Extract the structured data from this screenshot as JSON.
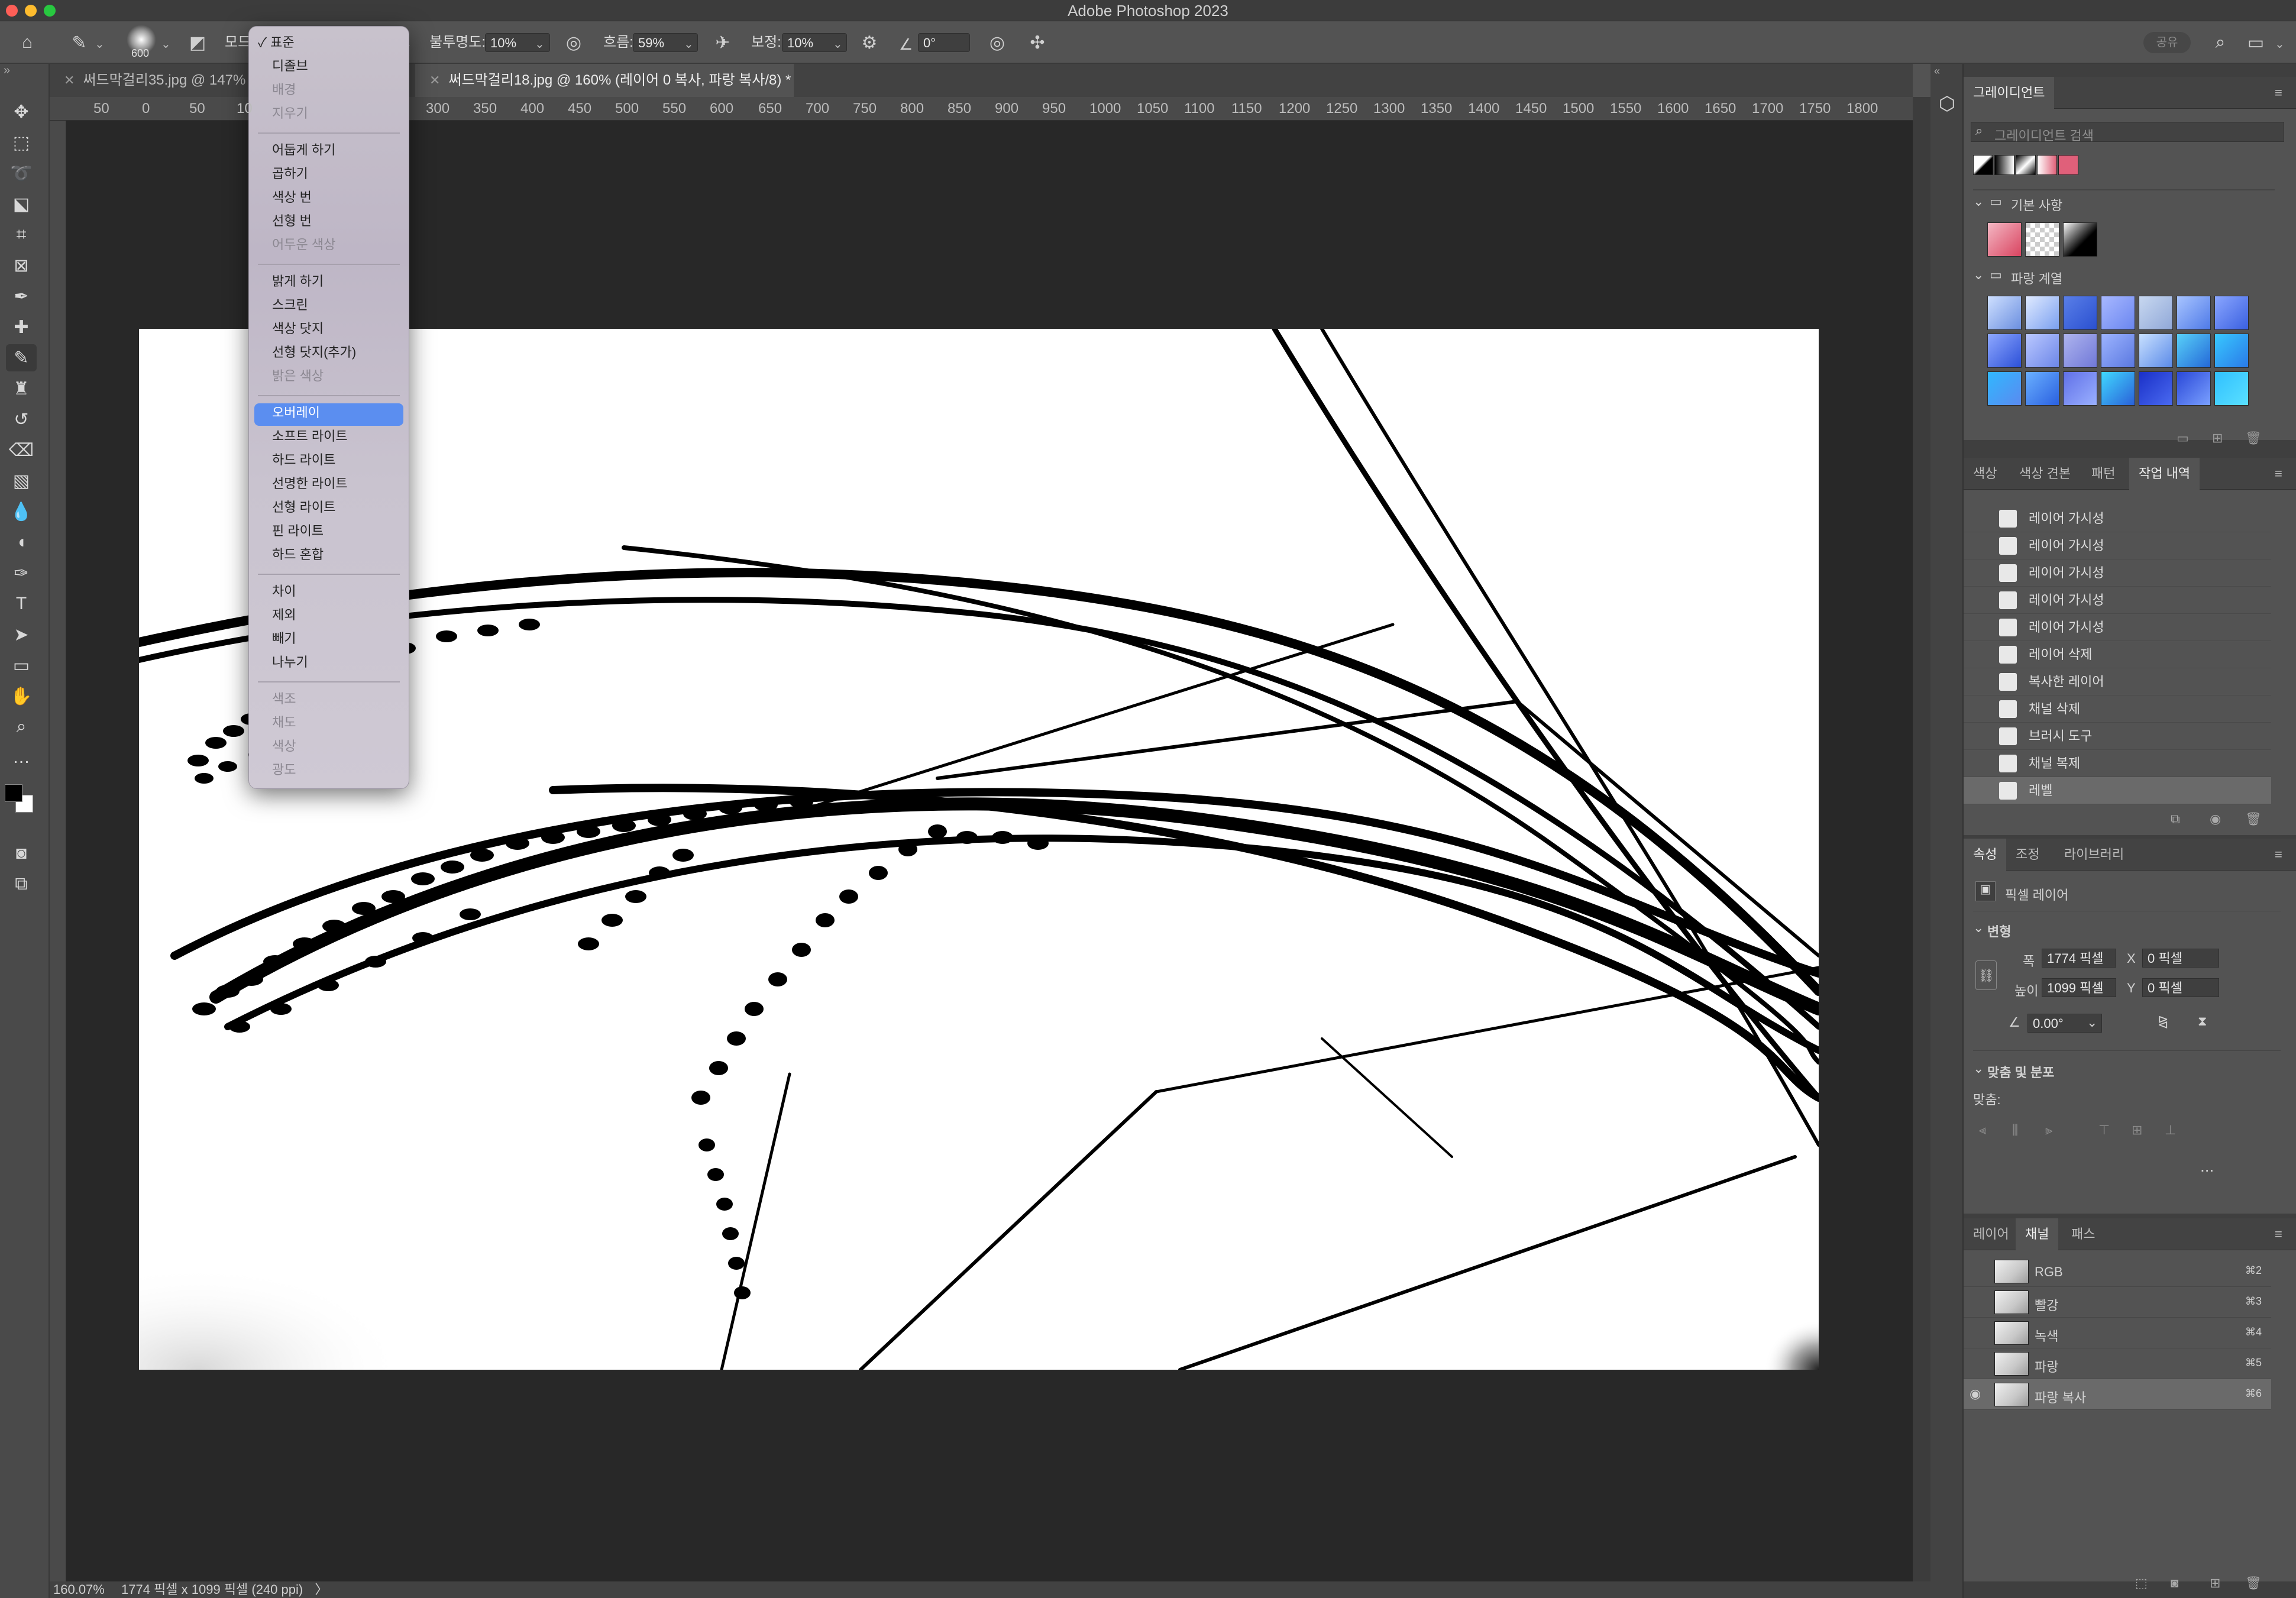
{
  "window": {
    "app_title": "Adobe Photoshop 2023"
  },
  "options_bar": {
    "brush_size": "600",
    "mode_label": "모드:",
    "opacity_label": "불투명도:",
    "opacity_value": "10%",
    "flow_label": "흐름:",
    "flow_value": "59%",
    "smoothing_label": "보정:",
    "smoothing_value": "10%",
    "angle_value": "0°",
    "share_label": "공유"
  },
  "tabs": [
    {
      "label": "써드막걸리35.jpg @ 147% ("
    },
    {
      "label": "써드막걸리18.jpg @ 160% (레이어 0 복사, 파랑 복사/8) *"
    }
  ],
  "ruler": {
    "top": [
      "50",
      "0",
      "50",
      "10",
      "300",
      "350",
      "400",
      "450",
      "500",
      "550",
      "600",
      "650",
      "700",
      "750",
      "800",
      "850",
      "900",
      "950",
      "1000",
      "1050",
      "1100",
      "1150",
      "1200",
      "1250",
      "1300",
      "1350",
      "1400",
      "1450",
      "1500",
      "1550",
      "1600",
      "1650",
      "1700",
      "1750",
      "1800"
    ]
  },
  "status": {
    "zoom": "160.07%",
    "doc_info": "1774 픽셀 x 1099 픽셀 (240 ppi)",
    "arrow": "〉"
  },
  "blend_menu": {
    "groups": [
      [
        {
          "label": "✓ 표준",
          "disabled": false
        },
        {
          "label": "디졸브",
          "disabled": false
        },
        {
          "label": "배경",
          "disabled": true
        },
        {
          "label": "지우기",
          "disabled": true
        }
      ],
      [
        {
          "label": "어둡게 하기",
          "disabled": false
        },
        {
          "label": "곱하기",
          "disabled": false
        },
        {
          "label": "색상 번",
          "disabled": false
        },
        {
          "label": "선형 번",
          "disabled": false
        },
        {
          "label": "어두운 색상",
          "disabled": true
        }
      ],
      [
        {
          "label": "밝게 하기",
          "disabled": false
        },
        {
          "label": "스크린",
          "disabled": false
        },
        {
          "label": "색상 닷지",
          "disabled": false
        },
        {
          "label": "선형 닷지(추가)",
          "disabled": false
        },
        {
          "label": "밝은 색상",
          "disabled": true
        }
      ],
      [
        {
          "label": "오버레이",
          "disabled": false,
          "selected": true
        },
        {
          "label": "소프트 라이트",
          "disabled": false
        },
        {
          "label": "하드 라이트",
          "disabled": false
        },
        {
          "label": "선명한 라이트",
          "disabled": false
        },
        {
          "label": "선형 라이트",
          "disabled": false
        },
        {
          "label": "핀 라이트",
          "disabled": false
        },
        {
          "label": "하드 혼합",
          "disabled": false
        }
      ],
      [
        {
          "label": "차이",
          "disabled": false
        },
        {
          "label": "제외",
          "disabled": false
        },
        {
          "label": "빼기",
          "disabled": false
        },
        {
          "label": "나누기",
          "disabled": false
        }
      ],
      [
        {
          "label": "색조",
          "disabled": true
        },
        {
          "label": "채도",
          "disabled": true
        },
        {
          "label": "색상",
          "disabled": true
        },
        {
          "label": "광도",
          "disabled": true
        }
      ]
    ]
  },
  "gradient_panel": {
    "tab": "그레이디언트",
    "search_placeholder": "그레이디언트 검색",
    "folders": [
      {
        "name": "기본 사항"
      },
      {
        "name": "파랑 계열"
      }
    ]
  },
  "history_panel": {
    "tabs": [
      "색상",
      "색상 견본",
      "패턴",
      "작업 내역"
    ],
    "active_tab": "작업 내역",
    "items": [
      "레이어 가시성",
      "레이어 가시성",
      "레이어 가시성",
      "레이어 가시성",
      "레이어 가시성",
      "레이어 삭제",
      "복사한 레이어",
      "채널 삭제",
      "브러시 도구",
      "채널 복제",
      "레벨"
    ]
  },
  "properties_panel": {
    "tabs": [
      "속성",
      "조정",
      "라이브러리"
    ],
    "layer_type": "픽셀 레이어",
    "transform_heading": "변형",
    "width_label": "폭",
    "width_value": "1774 픽셀",
    "height_label": "높이",
    "height_value": "1099 픽셀",
    "x_label": "X",
    "x_value": "0 픽셀",
    "y_label": "Y",
    "y_value": "0 픽셀",
    "angle_value": "0.00°",
    "align_heading": "맞춤 및 분포",
    "align_label": "맞춤:",
    "more": "..."
  },
  "channels_panel": {
    "tabs": [
      "레이어",
      "채널",
      "패스"
    ],
    "active_tab": "채널",
    "rows": [
      {
        "name": "RGB",
        "shortcut": "⌘2"
      },
      {
        "name": "빨강",
        "shortcut": "⌘3"
      },
      {
        "name": "녹색",
        "shortcut": "⌘4"
      },
      {
        "name": "파랑",
        "shortcut": "⌘5"
      },
      {
        "name": "파랑 복사",
        "shortcut": "⌘6"
      }
    ]
  },
  "colors": {
    "accent": "#5b8ef0",
    "ui_bg": "#535353",
    "canvas_bg": "#282828"
  }
}
